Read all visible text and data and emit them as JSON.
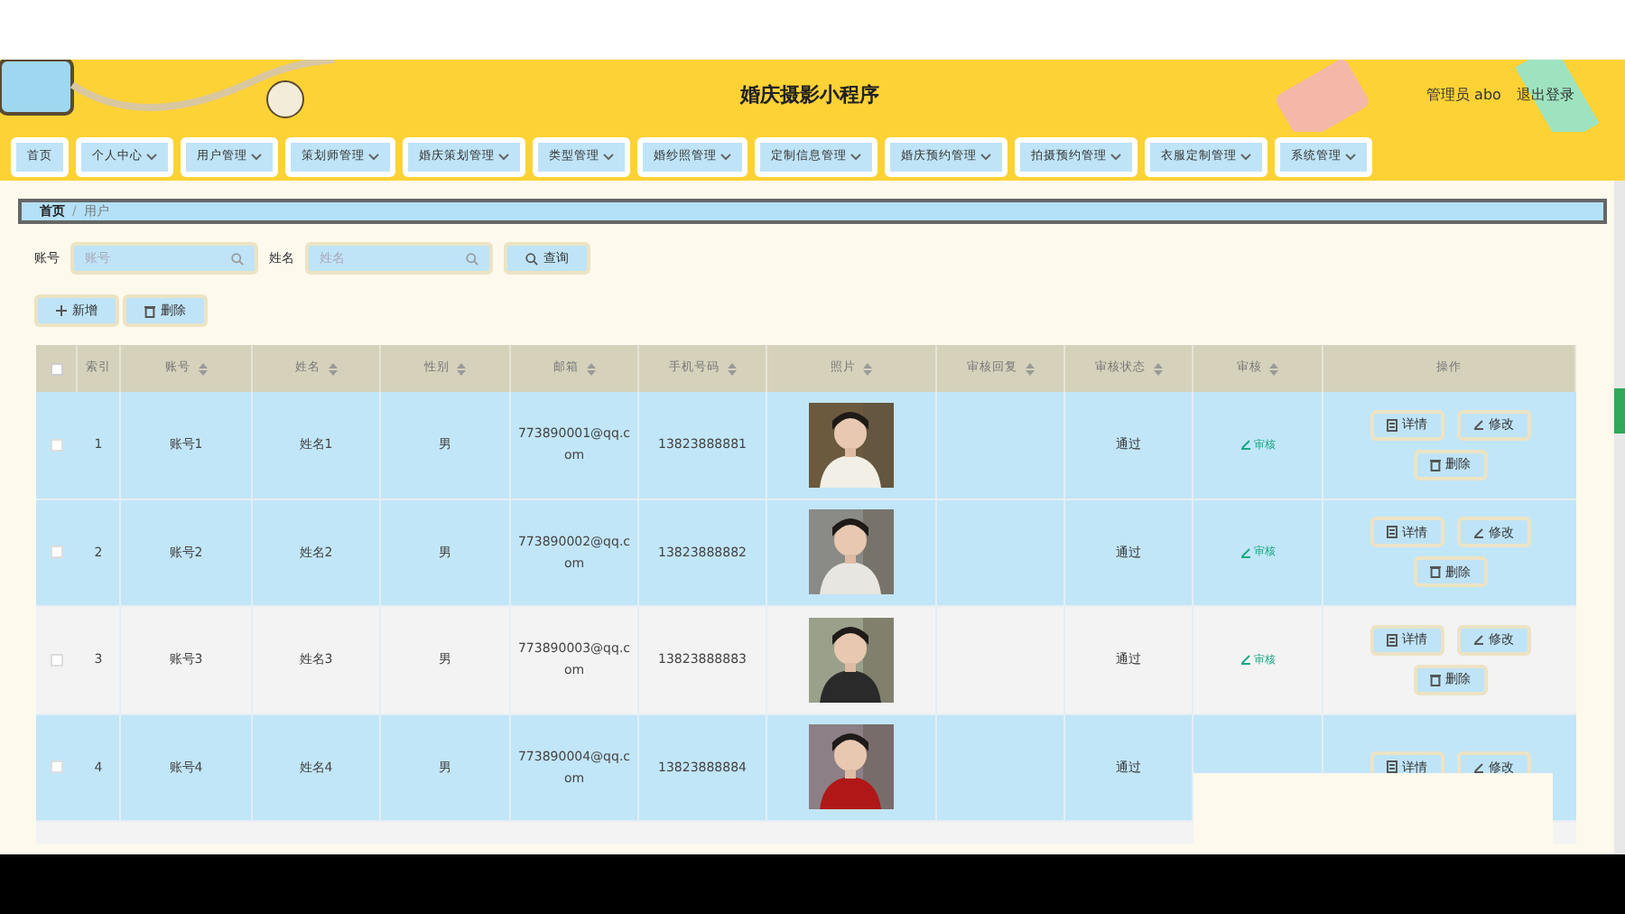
{
  "header": {
    "title": "婚庆摄影小程序",
    "user": "管理员 abo",
    "logout": "退出登录"
  },
  "nav": [
    {
      "label": "首页",
      "dropdown": false
    },
    {
      "label": "个人中心",
      "dropdown": true
    },
    {
      "label": "用户管理",
      "dropdown": true
    },
    {
      "label": "策划师管理",
      "dropdown": true
    },
    {
      "label": "婚庆策划管理",
      "dropdown": true
    },
    {
      "label": "类型管理",
      "dropdown": true
    },
    {
      "label": "婚纱照管理",
      "dropdown": true
    },
    {
      "label": "定制信息管理",
      "dropdown": true
    },
    {
      "label": "婚庆预约管理",
      "dropdown": true
    },
    {
      "label": "拍摄预约管理",
      "dropdown": true
    },
    {
      "label": "衣服定制管理",
      "dropdown": true
    },
    {
      "label": "系统管理",
      "dropdown": true
    }
  ],
  "breadcrumb": {
    "items": [
      "首页",
      "用户"
    ],
    "separator": "/"
  },
  "search": [
    {
      "label": "账号",
      "placeholder": "账号"
    },
    {
      "label": "姓名",
      "placeholder": "姓名"
    }
  ],
  "search_button": "查询",
  "actions": [
    {
      "kind": "add",
      "label": "新增"
    },
    {
      "kind": "delete",
      "label": "删除"
    }
  ],
  "table": {
    "select_all": {
      "checked": false
    },
    "columns": [
      {
        "label": "索引",
        "sortable": false
      },
      {
        "label": "账号",
        "sortable": true
      },
      {
        "label": "姓名",
        "sortable": true
      },
      {
        "label": "性别",
        "sortable": true
      },
      {
        "label": "邮箱",
        "sortable": true
      },
      {
        "label": "手机号码",
        "sortable": true
      },
      {
        "label": "照片",
        "sortable": true
      },
      {
        "label": "审核回复",
        "sortable": true
      },
      {
        "label": "审核状态",
        "sortable": true
      },
      {
        "label": "审核",
        "sortable": true
      },
      {
        "label": "操作",
        "sortable": false
      }
    ],
    "rows": [
      {
        "index": "1",
        "account": "账号1",
        "name": "姓名1",
        "gender": "男",
        "email": "773890001@qq.com",
        "phone": "13823888881",
        "status": "通过",
        "review": "审核",
        "buttons": [
          "详情",
          "修改",
          "删除"
        ],
        "highlighted": true,
        "checked": false
      },
      {
        "index": "2",
        "account": "账号2",
        "name": "姓名2",
        "gender": "男",
        "email": "773890002@qq.com",
        "phone": "13823888882",
        "status": "通过",
        "review": "审核",
        "buttons": [
          "详情",
          "修改",
          "删除"
        ],
        "highlighted": true,
        "checked": false
      },
      {
        "index": "3",
        "account": "账号3",
        "name": "姓名3",
        "gender": "男",
        "email": "773890003@qq.com",
        "phone": "13823888883",
        "status": "通过",
        "review": "审核",
        "buttons": [
          "详情",
          "修改",
          "删除"
        ],
        "highlighted": false,
        "checked": false
      },
      {
        "index": "4",
        "account": "账号4",
        "name": "姓名4",
        "gender": "男",
        "email": "773890004@qq.com",
        "phone": "13823888884",
        "status": "通过",
        "buttons": [
          "详情",
          "修改"
        ],
        "highlighted": true,
        "checked": false
      }
    ]
  }
}
